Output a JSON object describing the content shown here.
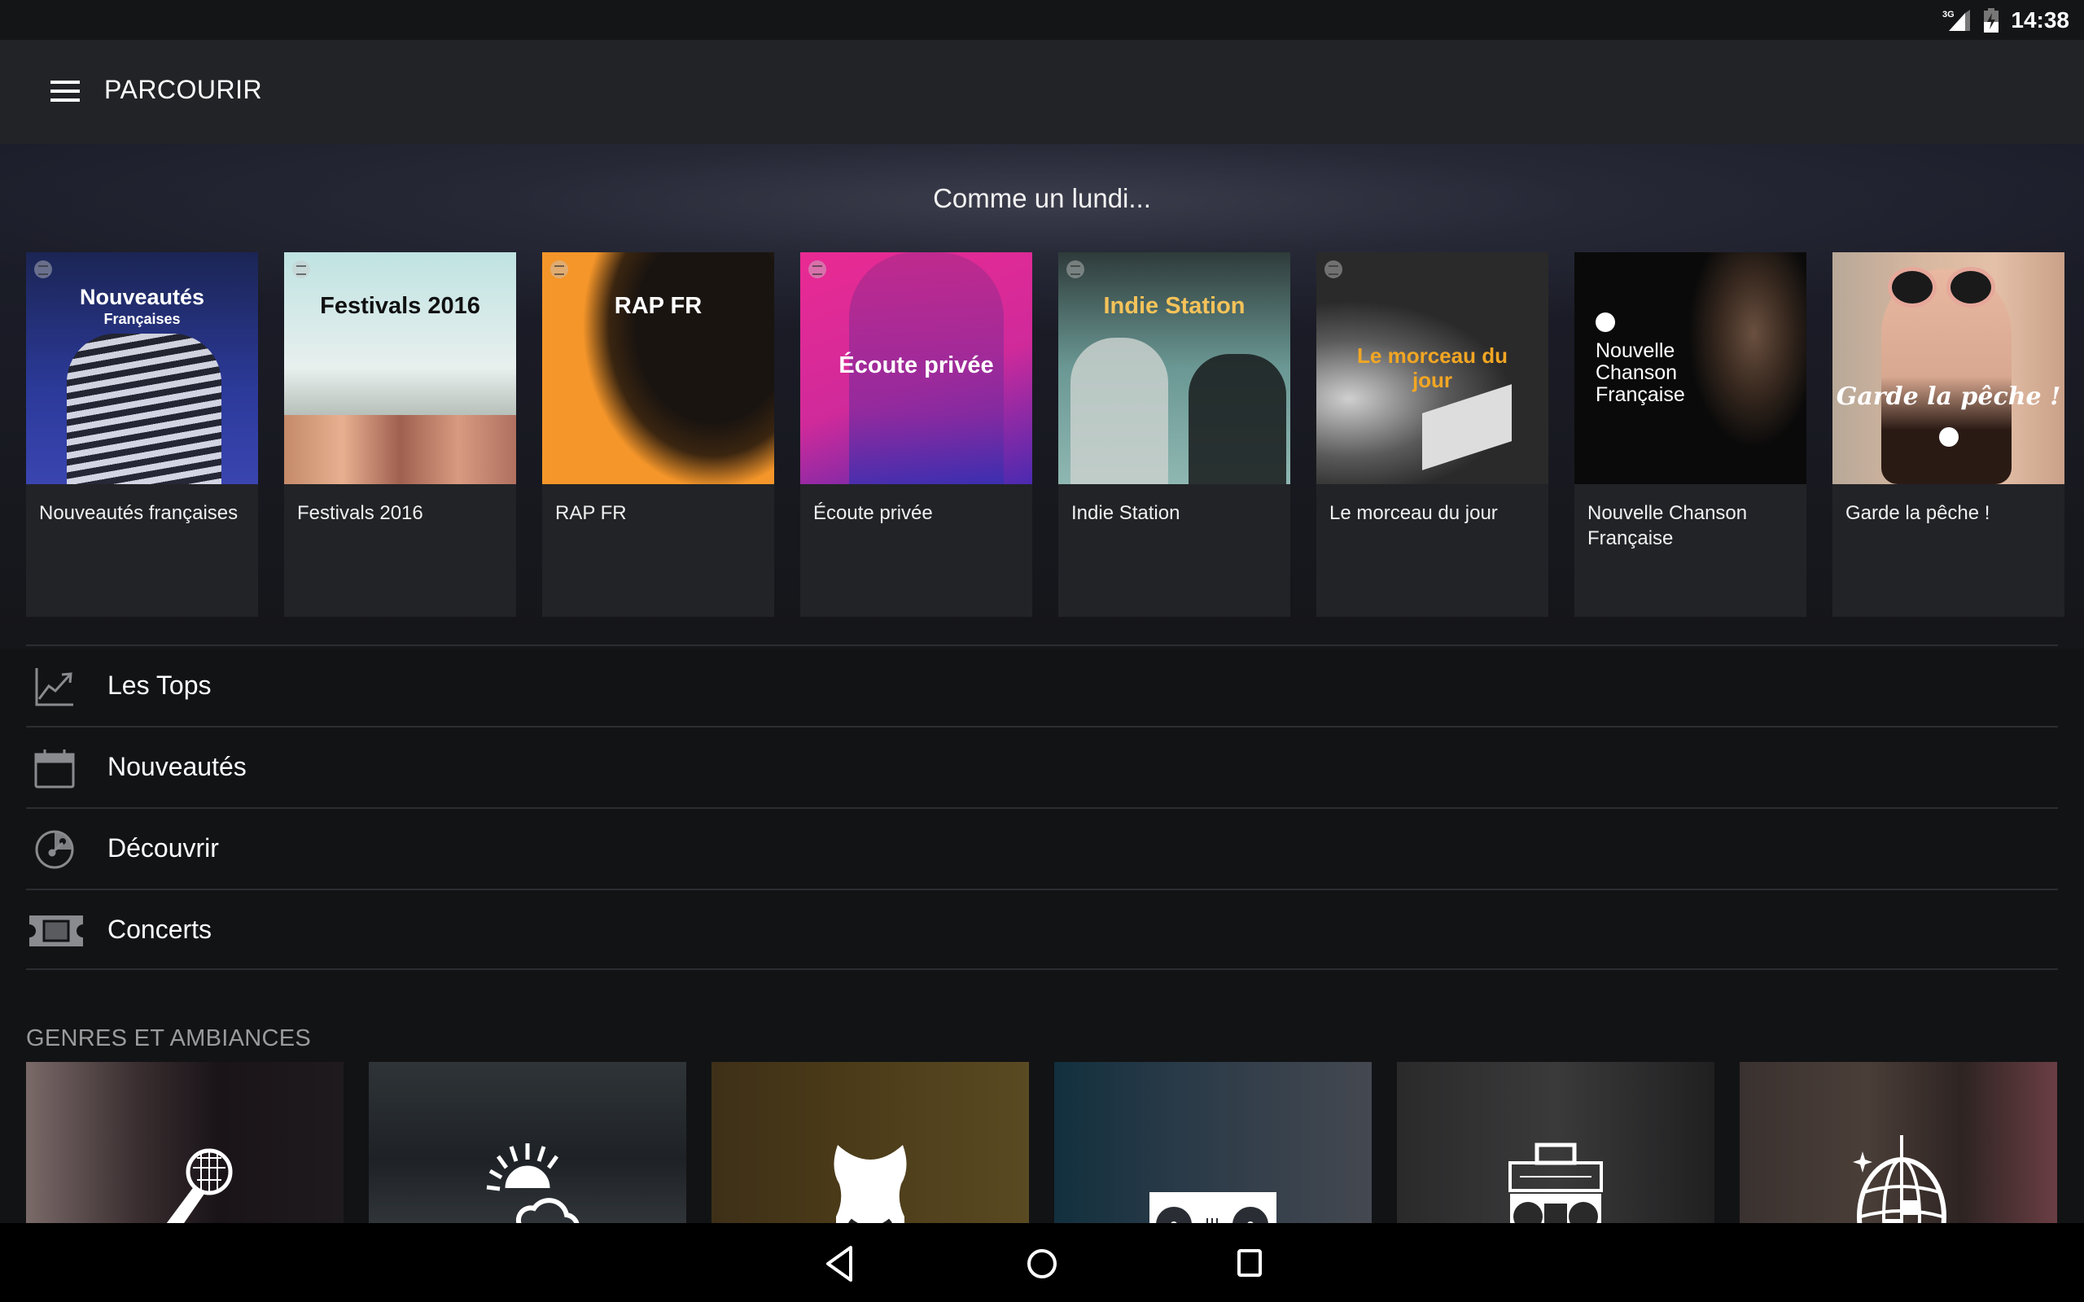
{
  "status_bar": {
    "network": "3G",
    "network_icon": "signal-3g-icon",
    "battery_icon": "battery-charging-icon",
    "time": "14:38"
  },
  "toolbar": {
    "menu_icon": "hamburger-menu-icon",
    "title": "PARCOURIR"
  },
  "featured": {
    "title": "Comme un lundi...",
    "playlists": [
      {
        "caption": "Nouveautés françaises",
        "art_title": "Nouveautés",
        "art_subtitle": "Françaises",
        "art_color": "#2c3a9a",
        "text_color": "#ffffff"
      },
      {
        "caption": "Festivals 2016",
        "art_title": "Festivals 2016",
        "art_subtitle": "",
        "art_color": "#bfe0df",
        "text_color": "#111111"
      },
      {
        "caption": "RAP FR",
        "art_title": "RAP FR",
        "art_subtitle": "",
        "art_color": "#f5962a",
        "text_color": "#ffffff"
      },
      {
        "caption": "Écoute privée",
        "art_title": "Écoute privée",
        "art_subtitle": "",
        "art_color": "#ea2a93",
        "text_color": "#ffffff"
      },
      {
        "caption": "Indie Station",
        "art_title": "Indie Station",
        "art_subtitle": "",
        "art_color": "#5f8a86",
        "text_color": "#f5c35a"
      },
      {
        "caption": "Le morceau du jour",
        "art_title": "Le morceau du jour",
        "art_subtitle": "",
        "art_color": "#5a5a5a",
        "text_color": "#f2a623"
      },
      {
        "caption": "Nouvelle Chanson Française",
        "art_title": "Nouvelle Chanson Française",
        "art_subtitle": "",
        "art_color": "#0a0a0a",
        "text_color": "#ffffff"
      },
      {
        "caption": "Garde la pêche !",
        "art_title": "Garde la pêche !",
        "art_subtitle": "",
        "art_color": "#c89a7a",
        "text_color": "#ffffff"
      }
    ]
  },
  "browse_rows": [
    {
      "label": "Les Tops",
      "icon": "chart-trending-icon"
    },
    {
      "label": "Nouveautés",
      "icon": "calendar-icon"
    },
    {
      "label": "Découvrir",
      "icon": "discover-dial-icon"
    },
    {
      "label": "Concerts",
      "icon": "ticket-icon"
    }
  ],
  "genres": {
    "title": "GENRES ET AMBIANCES",
    "tiles": [
      {
        "icon": "microphone-icon",
        "bg": "#2a2326"
      },
      {
        "icon": "sun-cloud-icon",
        "bg": "#2b3034"
      },
      {
        "icon": "armchair-icon",
        "bg": "#4a3a18"
      },
      {
        "icon": "turntables-icon",
        "bg": "#2c3a46"
      },
      {
        "icon": "boombox-icon",
        "bg": "#2e2e2f"
      },
      {
        "icon": "disco-ball-icon",
        "bg": "#3a2f2d"
      }
    ]
  },
  "nav_bar": {
    "back_icon": "back-triangle-icon",
    "home_icon": "home-circle-icon",
    "recents_icon": "recents-square-icon"
  }
}
